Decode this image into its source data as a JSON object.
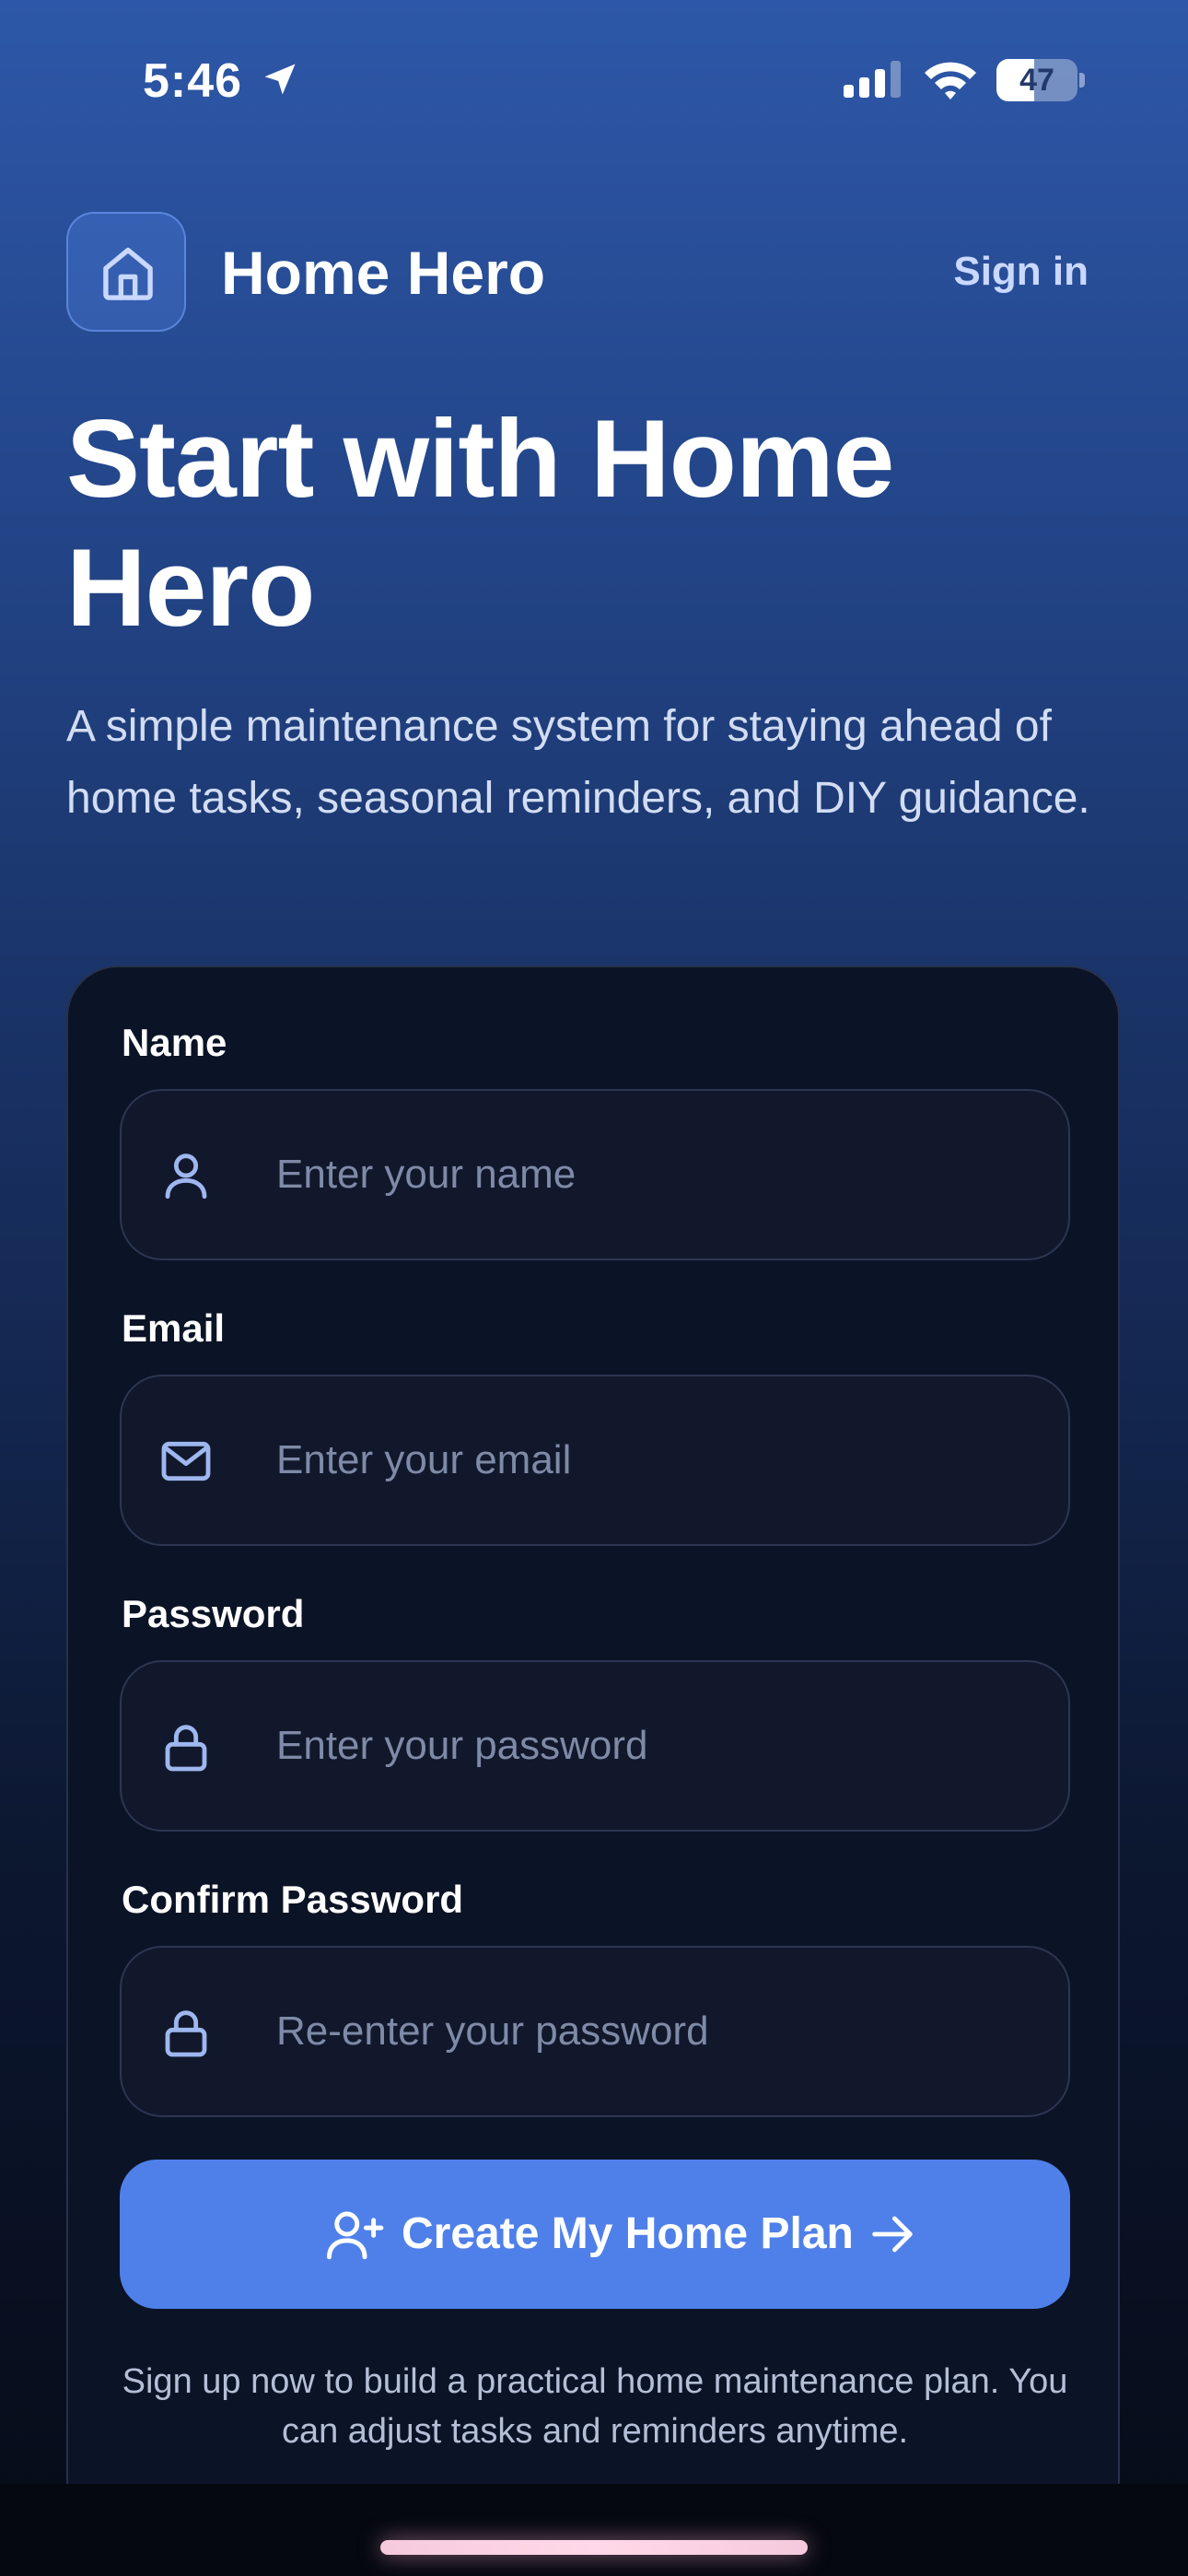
{
  "status_bar": {
    "time": "5:46",
    "battery": "47",
    "battery_level": 0.47,
    "icons": [
      "location-arrow-icon",
      "cellular-signal-icon",
      "wifi-icon",
      "battery-icon"
    ]
  },
  "header": {
    "logo_icon": "home-icon",
    "app_name": "Home Hero",
    "signin_label": "Sign in"
  },
  "hero": {
    "title": "Start with Home Hero",
    "subtitle": "A simple maintenance system for staying ahead of home tasks, seasonal reminders, and DIY guidance."
  },
  "form": {
    "fields": [
      {
        "label": "Name",
        "placeholder": "Enter your name",
        "value": "",
        "icon": "user-icon"
      },
      {
        "label": "Email",
        "placeholder": "Enter your email",
        "value": "",
        "icon": "mail-icon"
      },
      {
        "label": "Password",
        "placeholder": "Enter your password",
        "value": "",
        "icon": "lock-icon"
      },
      {
        "label": "Confirm Password",
        "placeholder": "Re-enter your password",
        "value": "",
        "icon": "lock-icon"
      }
    ],
    "submit_label": "Create My Home Plan",
    "submit_icons": [
      "user-plus-icon",
      "arrow-right-icon"
    ],
    "footnote": "Sign up now to build a practical home maintenance plan. You can adjust tasks and reminders anytime."
  },
  "colors": {
    "background_top": "#2d57a8",
    "background_bottom": "#060b17",
    "card": "#0b1326",
    "accent": "#4f80ea",
    "signin_text": "#c9d8ff"
  }
}
